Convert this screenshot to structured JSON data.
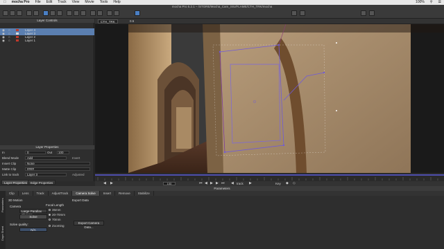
{
  "menubar": {
    "apple": "",
    "app_name": "mocha Pro",
    "items": [
      "File",
      "Edit",
      "Track",
      "View",
      "Movie",
      "Tools",
      "Help"
    ],
    "battery": "100%",
    "clock": ""
  },
  "window": {
    "title": "mocha Pro 5.2.1 – /STORE/Mocha_Cam_SIU/FLAME/CTH_TRK/mocha"
  },
  "layer_controls": {
    "header": "Layer Controls",
    "layers": [
      {
        "name": "Layer 4",
        "color": "#c0392b",
        "selected": true
      },
      {
        "name": "Layer 3",
        "color": "#d9d9d9",
        "selected": true
      },
      {
        "name": "Layer 2",
        "color": "#c0392b",
        "selected": false
      },
      {
        "name": "Layer 1",
        "color": "#c0392b",
        "selected": false
      }
    ]
  },
  "layer_properties": {
    "header": "Layer Properties",
    "in_label": "In",
    "in_value": "0",
    "out_label": "Out",
    "out_value": "100",
    "blend_mode_label": "Blend Mode",
    "blend_mode_value": "Add",
    "invert_label": "Invert",
    "insert_clip_label": "Insert Clip",
    "insert_clip_value": "None",
    "matte_clip_label": "Matte Clip",
    "matte_clip_value": "####",
    "link_to_track_label": "Link to track",
    "link_to_track_value": "Layer 3",
    "adjusted_label": "Adjusted"
  },
  "left_tabs": [
    "Layer Properties",
    "Edge Properties"
  ],
  "viewer": {
    "clip_name": "CTH_TRK",
    "zoom": "0.5"
  },
  "transport": {
    "frame": "100",
    "track_label": "track",
    "key_label": "Key"
  },
  "parameters": {
    "header": "Parameters",
    "tabs": [
      "Clip",
      "Lens",
      "Track",
      "AdjustTrack",
      "Camera Solve",
      "Insert",
      "Remove",
      "Stabilize"
    ],
    "active_tab": "Camera Solve",
    "side_tabs": [
      "Parameters",
      "Dope Sheet"
    ],
    "solve_section": "3D Motion",
    "camera_label": "Camera",
    "motion_type": "Large Parallax Change",
    "solve_button": "Solve",
    "solve_quality_label": "Solve quality:",
    "solve_quality_value": "N/A",
    "focal_length_label": "Focal Length",
    "focal_options": [
      "35mm",
      "20-70mm",
      "70mm",
      "Zooming"
    ],
    "focal_selected": "20-70mm",
    "export_data_label": "Export Data",
    "export_button": "Export Camera Data..."
  }
}
